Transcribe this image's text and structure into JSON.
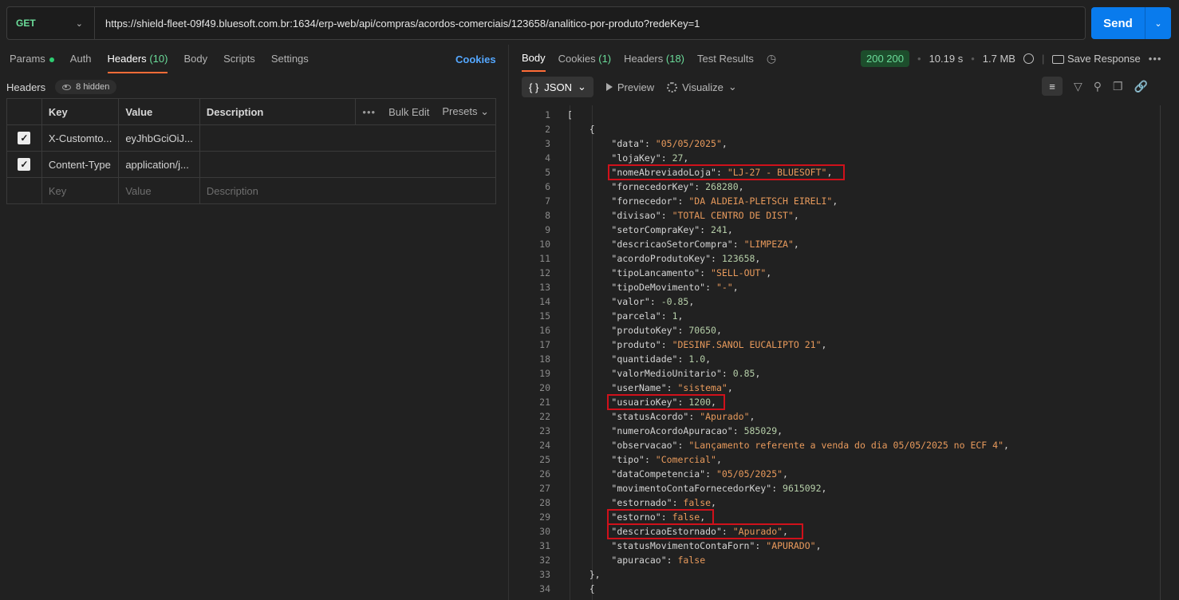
{
  "request": {
    "method": "GET",
    "url": "https://shield-fleet-09f49.bluesoft.com.br:1634/erp-web/api/compras/acordos-comerciais/123658/analitico-por-produto?redeKey=1",
    "send_label": "Send"
  },
  "left_tabs": [
    {
      "label": "Params",
      "count": ""
    },
    {
      "label": "Auth",
      "count": ""
    },
    {
      "label": "Headers",
      "count": "(10)"
    },
    {
      "label": "Body",
      "count": ""
    },
    {
      "label": "Scripts",
      "count": ""
    },
    {
      "label": "Settings",
      "count": ""
    }
  ],
  "cookies_link": "Cookies",
  "headers_section": {
    "label": "Headers",
    "hidden": "8 hidden",
    "columns": [
      "Key",
      "Value",
      "Description"
    ],
    "bulk_edit": "Bulk Edit",
    "presets": "Presets",
    "rows": [
      {
        "key": "X-Customto...",
        "value": "eyJhbGciOiJ..."
      },
      {
        "key": "Content-Type",
        "value": "application/j..."
      }
    ],
    "placeholders": {
      "key": "Key",
      "value": "Value",
      "description": "Description"
    }
  },
  "response_tabs": [
    {
      "label": "Body",
      "count": ""
    },
    {
      "label": "Cookies",
      "count": "(1)"
    },
    {
      "label": "Headers",
      "count": "(18)"
    },
    {
      "label": "Test Results",
      "count": ""
    }
  ],
  "response_status": {
    "code": "200 200",
    "time": "10.19 s",
    "size": "1.7 MB",
    "save": "Save Response"
  },
  "body_toolbar": {
    "format": "JSON",
    "preview": "Preview",
    "visualize": "Visualize"
  },
  "accent_colors": {
    "send": "#097bed",
    "tab_underline": "#ff6c37",
    "highlight": "#d0111b"
  },
  "json_lines": [
    {
      "n": "1",
      "t": "["
    },
    {
      "n": "2",
      "t": "    {"
    },
    {
      "n": "3",
      "k": "\"data\"",
      "v": "\"05/05/2025\"",
      "vt": "s",
      "end": ","
    },
    {
      "n": "4",
      "k": "\"lojaKey\"",
      "v": "27",
      "vt": "n",
      "end": ","
    },
    {
      "n": "5",
      "k": "\"nomeAbreviadoLoja\"",
      "v": "\"LJ-27 - BLUESOFT\"",
      "vt": "s",
      "end": ","
    },
    {
      "n": "6",
      "k": "\"fornecedorKey\"",
      "v": "268280",
      "vt": "n",
      "end": ","
    },
    {
      "n": "7",
      "k": "\"fornecedor\"",
      "v": "\"DA ALDEIA-PLETSCH EIRELI\"",
      "vt": "s",
      "end": ","
    },
    {
      "n": "8",
      "k": "\"divisao\"",
      "v": "\"TOTAL CENTRO DE DIST\"",
      "vt": "s",
      "end": ","
    },
    {
      "n": "9",
      "k": "\"setorCompraKey\"",
      "v": "241",
      "vt": "n",
      "end": ","
    },
    {
      "n": "10",
      "k": "\"descricaoSetorCompra\"",
      "v": "\"LIMPEZA\"",
      "vt": "s",
      "end": ","
    },
    {
      "n": "11",
      "k": "\"acordoProdutoKey\"",
      "v": "123658",
      "vt": "n",
      "end": ","
    },
    {
      "n": "12",
      "k": "\"tipoLancamento\"",
      "v": "\"SELL-OUT\"",
      "vt": "s",
      "end": ","
    },
    {
      "n": "13",
      "k": "\"tipoDeMovimento\"",
      "v": "\"-\"",
      "vt": "s",
      "end": ","
    },
    {
      "n": "14",
      "k": "\"valor\"",
      "v": "-0.85",
      "vt": "n",
      "end": ","
    },
    {
      "n": "15",
      "k": "\"parcela\"",
      "v": "1",
      "vt": "n",
      "end": ","
    },
    {
      "n": "16",
      "k": "\"produtoKey\"",
      "v": "70650",
      "vt": "n",
      "end": ","
    },
    {
      "n": "17",
      "k": "\"produto\"",
      "v": "\"DESINF.SANOL EUCALIPTO 21\"",
      "vt": "s",
      "end": ","
    },
    {
      "n": "18",
      "k": "\"quantidade\"",
      "v": "1.0",
      "vt": "n",
      "end": ","
    },
    {
      "n": "19",
      "k": "\"valorMedioUnitario\"",
      "v": "0.85",
      "vt": "n",
      "end": ","
    },
    {
      "n": "20",
      "k": "\"userName\"",
      "v": "\"sistema\"",
      "vt": "s",
      "end": ","
    },
    {
      "n": "21",
      "k": "\"usuarioKey\"",
      "v": "1200",
      "vt": "n",
      "end": ","
    },
    {
      "n": "22",
      "k": "\"statusAcordo\"",
      "v": "\"Apurado\"",
      "vt": "s",
      "end": ","
    },
    {
      "n": "23",
      "k": "\"numeroAcordoApuracao\"",
      "v": "585029",
      "vt": "n",
      "end": ","
    },
    {
      "n": "24",
      "k": "\"observacao\"",
      "v": "\"Lançamento referente a venda do dia 05/05/2025 no ECF 4\"",
      "vt": "s",
      "end": ","
    },
    {
      "n": "25",
      "k": "\"tipo\"",
      "v": "\"Comercial\"",
      "vt": "s",
      "end": ","
    },
    {
      "n": "26",
      "k": "\"dataCompetencia\"",
      "v": "\"05/05/2025\"",
      "vt": "s",
      "end": ","
    },
    {
      "n": "27",
      "k": "\"movimentoContaFornecedorKey\"",
      "v": "9615092",
      "vt": "n",
      "end": ","
    },
    {
      "n": "28",
      "k": "\"estornado\"",
      "v": "false",
      "vt": "b",
      "end": ","
    },
    {
      "n": "29",
      "k": "\"estorno\"",
      "v": "false",
      "vt": "b",
      "end": ","
    },
    {
      "n": "30",
      "k": "\"descricaoEstornado\"",
      "v": "\"Apurado\"",
      "vt": "s",
      "end": ","
    },
    {
      "n": "31",
      "k": "\"statusMovimentoContaForn\"",
      "v": "\"APURADO\"",
      "vt": "s",
      "end": ","
    },
    {
      "n": "32",
      "k": "\"apuracao\"",
      "v": "false",
      "vt": "b",
      "end": ""
    },
    {
      "n": "33",
      "t": "    },"
    },
    {
      "n": "34",
      "t": "    {"
    }
  ]
}
